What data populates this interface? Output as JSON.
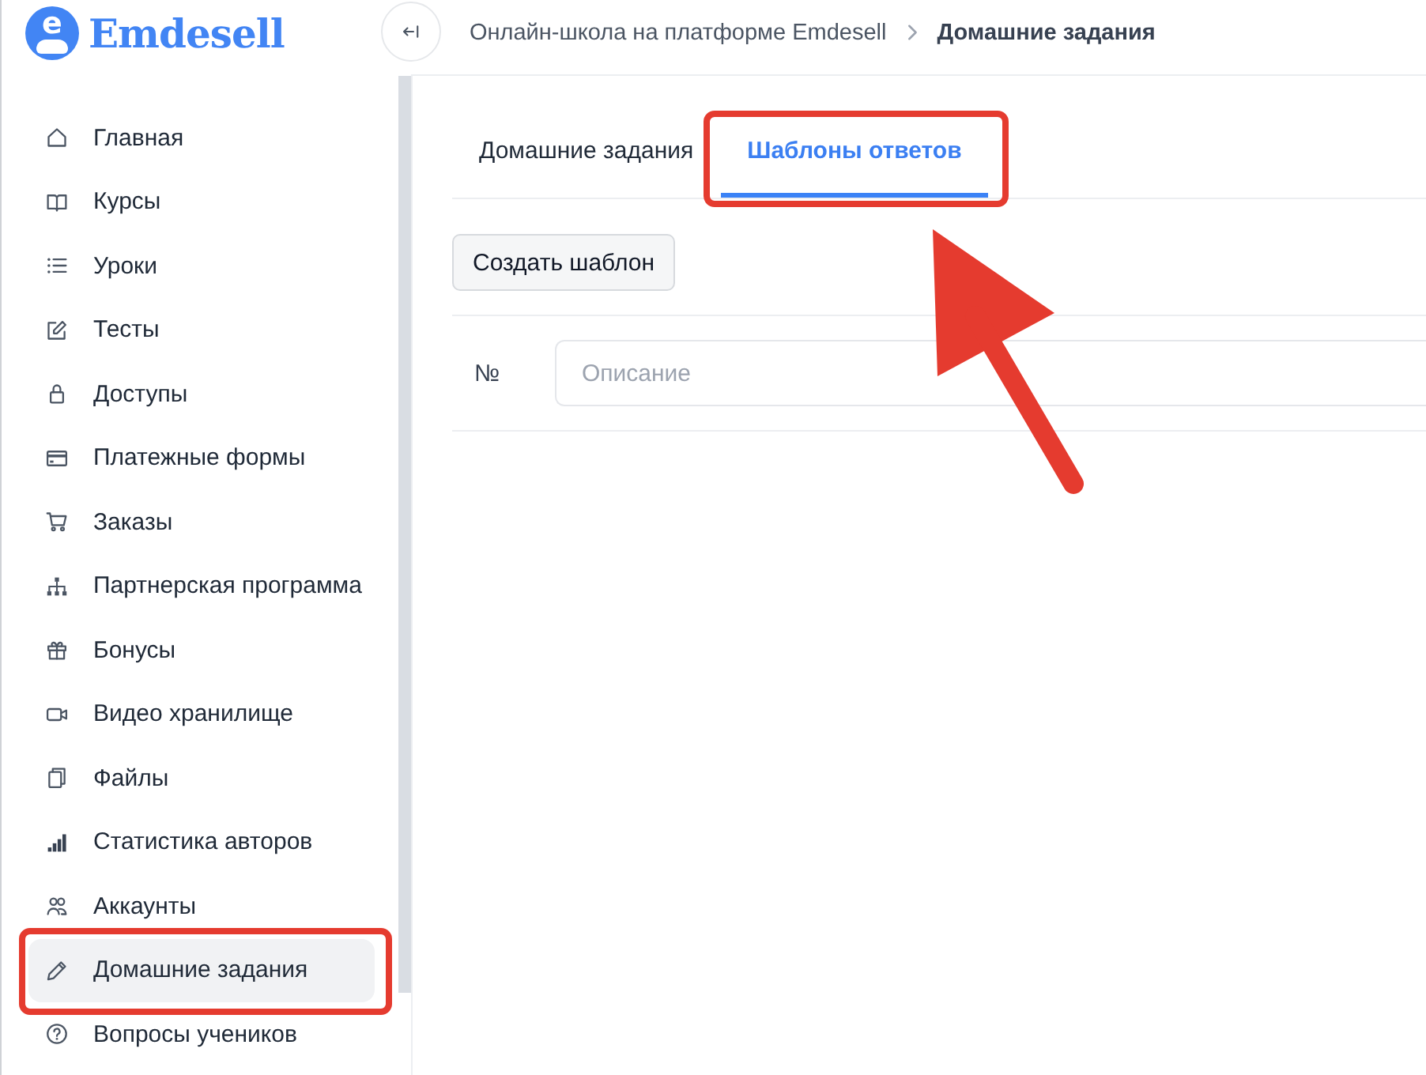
{
  "logo": {
    "mark": "e",
    "name": "Emdesell"
  },
  "breadcrumbs": [
    {
      "label": "Онлайн-школа на платформе Emdesell",
      "current": false
    },
    {
      "label": "Домашние задания",
      "current": true
    }
  ],
  "sidebar": {
    "items": [
      {
        "label": "Главная",
        "selected": false,
        "highlighted": false
      },
      {
        "label": "Курсы",
        "selected": false,
        "highlighted": false
      },
      {
        "label": "Уроки",
        "selected": false,
        "highlighted": false
      },
      {
        "label": "Тесты",
        "selected": false,
        "highlighted": false
      },
      {
        "label": "Доступы",
        "selected": false,
        "highlighted": false
      },
      {
        "label": "Платежные формы",
        "selected": false,
        "highlighted": false
      },
      {
        "label": "Заказы",
        "selected": false,
        "highlighted": false
      },
      {
        "label": "Партнерская программа",
        "selected": false,
        "highlighted": false
      },
      {
        "label": "Бонусы",
        "selected": false,
        "highlighted": false
      },
      {
        "label": "Видео хранилище",
        "selected": false,
        "highlighted": false
      },
      {
        "label": "Файлы",
        "selected": false,
        "highlighted": false
      },
      {
        "label": "Статистика авторов",
        "selected": false,
        "highlighted": false
      },
      {
        "label": "Аккаунты",
        "selected": false,
        "highlighted": false
      },
      {
        "label": "Домашние задания",
        "selected": true,
        "highlighted": true
      },
      {
        "label": "Вопросы учеников",
        "selected": false,
        "highlighted": false
      }
    ]
  },
  "tabs": [
    {
      "label": "Домашние задания",
      "selected": false,
      "highlighted": false
    },
    {
      "label": "Шаблоны ответов",
      "selected": true,
      "highlighted": true
    }
  ],
  "create_button": {
    "label": "Создать шаблон"
  },
  "table": {
    "number_header": "№",
    "description_filter": {
      "placeholder": "Описание"
    }
  }
}
